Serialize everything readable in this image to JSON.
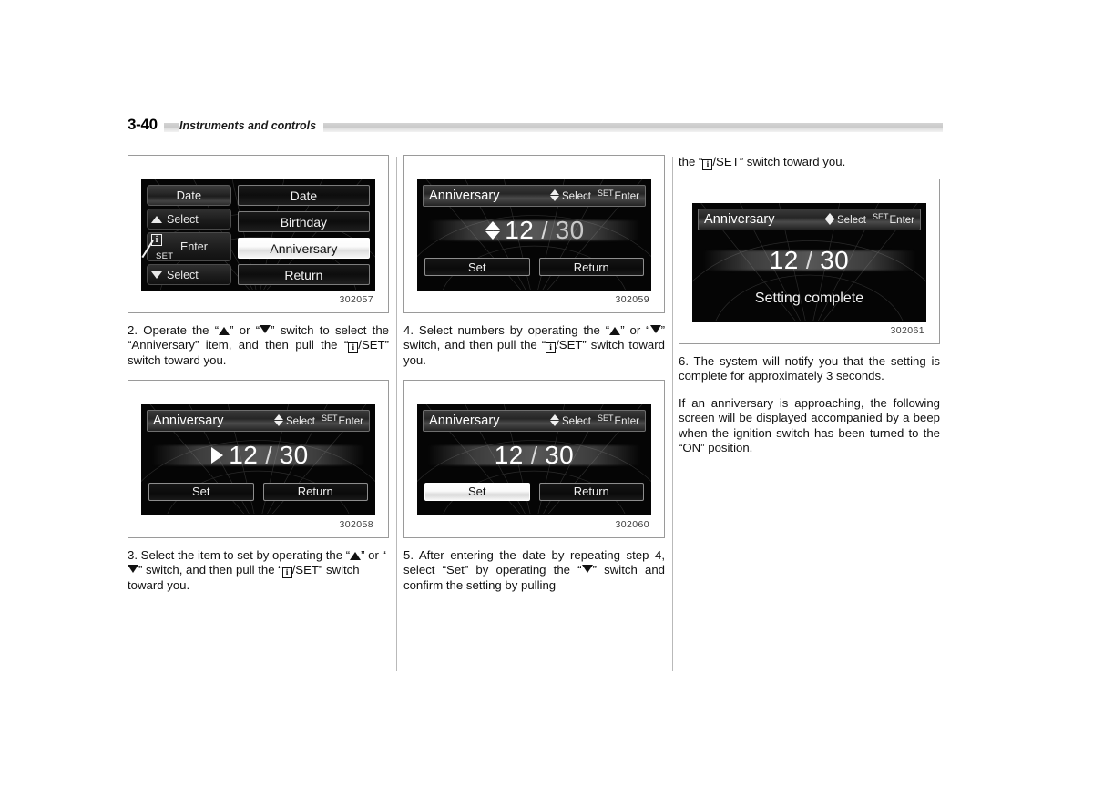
{
  "page": {
    "number": "3-40",
    "section_title": "Instruments and controls"
  },
  "figures": {
    "menu": {
      "id": "302057",
      "switch_panel": {
        "title_key": "Date",
        "up_label": "Select",
        "enter_label": "Enter",
        "enter_icon_top": "i",
        "enter_icon_bottom": "SET",
        "down_label": "Select"
      },
      "menu_items": [
        {
          "label": "Date",
          "selected": false
        },
        {
          "label": "Birthday",
          "selected": false
        },
        {
          "label": "Anniversary",
          "selected": true
        },
        {
          "label": "Return",
          "selected": false
        }
      ]
    },
    "anniv_marker": {
      "id": "302058",
      "title": "Anniversary",
      "hint_select": "Select",
      "hint_set": "SET",
      "hint_enter": "Enter",
      "month": "12",
      "separator": "/",
      "day": "30",
      "buttons": [
        {
          "label": "Set",
          "selected": false
        },
        {
          "label": "Return",
          "selected": false
        }
      ]
    },
    "anniv_updown": {
      "id": "302059",
      "title": "Anniversary",
      "hint_select": "Select",
      "hint_set": "SET",
      "hint_enter": "Enter",
      "month": "12",
      "separator": "/",
      "day": "30",
      "buttons": [
        {
          "label": "Set",
          "selected": false
        },
        {
          "label": "Return",
          "selected": false
        }
      ]
    },
    "anniv_setsel": {
      "id": "302060",
      "title": "Anniversary",
      "hint_select": "Select",
      "hint_set": "SET",
      "hint_enter": "Enter",
      "month": "12",
      "separator": "/",
      "day": "30",
      "buttons": [
        {
          "label": "Set",
          "selected": true
        },
        {
          "label": "Return",
          "selected": false
        }
      ]
    },
    "complete": {
      "id": "302061",
      "title": "Anniversary",
      "hint_select": "Select",
      "hint_set": "SET",
      "hint_enter": "Enter",
      "month": "12",
      "separator": "/",
      "day": "30",
      "message": "Setting complete"
    }
  },
  "text": {
    "step2": {
      "a": "2. Operate the “",
      "b": "” or “",
      "c": "” switch to select the “Anniversary” item, and then pull the “",
      "d": "/SET” switch toward you."
    },
    "step3": {
      "a": "3.  Select the item to set by operating the “",
      "b": "” or “",
      "c": "” switch, and then pull the “",
      "d": "/SET” switch toward you."
    },
    "step4": {
      "a": "4.  Select numbers by operating the “",
      "b": "” or “",
      "c": "” switch, and then pull the “",
      "d": "/SET” switch toward you."
    },
    "step5": {
      "a": "5.  After entering the date by repeating step 4, select “Set” by operating the “",
      "b": "” switch and confirm the setting by pulling"
    },
    "step5_cont": {
      "a": "the “",
      "b": "/SET” switch toward you."
    },
    "step6": "6.  The system will notify you that the setting is complete for approximately 3 seconds.",
    "note": "If an anniversary is approaching, the following screen will be displayed accompanied by a beep when the ignition switch has been turned to the “ON” position."
  }
}
